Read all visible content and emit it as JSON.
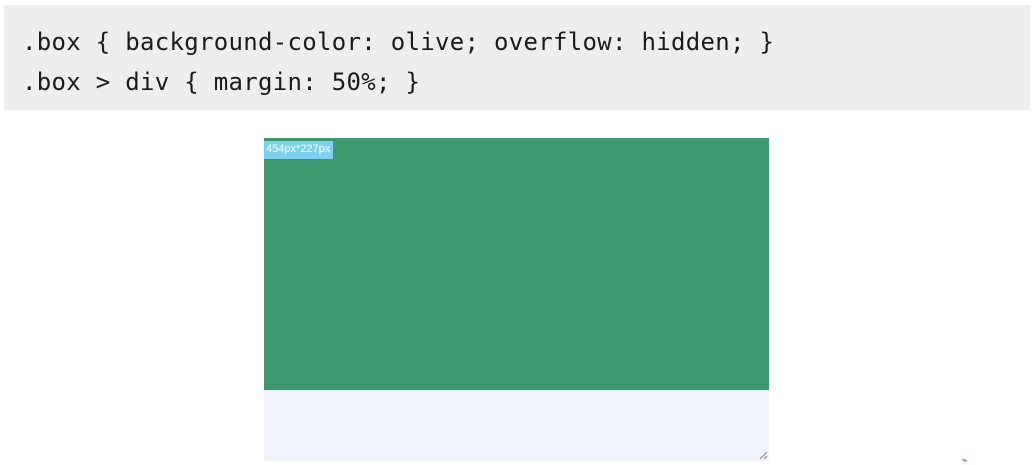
{
  "code": {
    "line1": ".box { background-color: olive; overflow: hidden; }",
    "line2": ".box > div { margin: 50%; }"
  },
  "demo": {
    "size_label": "454px*227px",
    "inner_color": "#3f976f",
    "box_color": "#f0f3fa",
    "tag_color": "#7fd0ee"
  },
  "icons": {
    "resize": "resize-grip-icon",
    "cursor": "cursor-mark-icon"
  }
}
